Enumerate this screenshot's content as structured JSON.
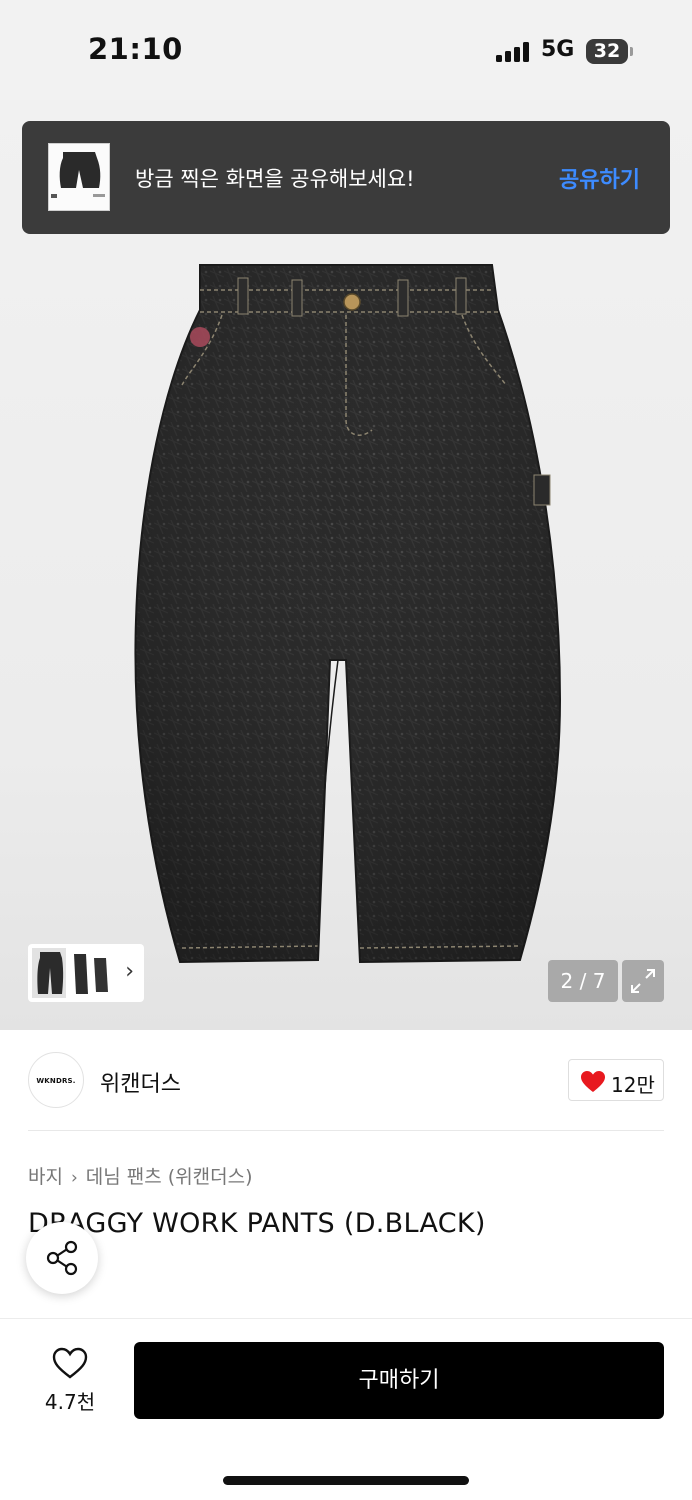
{
  "status_bar": {
    "time": "21:10",
    "network": "5G",
    "battery": "32"
  },
  "toast": {
    "message": "방금 찍은 화면을 공유해보세요!",
    "action": "공유하기"
  },
  "gallery": {
    "counter": "2 / 7",
    "thumb_arrow": "›"
  },
  "brand": {
    "logo_text": "WKNDRS.",
    "name": "위캔더스",
    "likes": "12만"
  },
  "breadcrumb": {
    "items": [
      "바지",
      "데님 팬츠 (위캔더스)"
    ],
    "separator": "›"
  },
  "product": {
    "title": "DRAGGY WORK PANTS (D.BLACK)"
  },
  "bottom_bar": {
    "wishlist_count": "4.7천",
    "buy_label": "구매하기"
  },
  "colors": {
    "accent_blue": "#3d8bff",
    "like_red": "#e8191f",
    "buy_black": "#000000",
    "toast_bg": "#3b3b3b"
  },
  "icons": [
    "signal-icon",
    "battery-icon",
    "heart-icon",
    "expand-icon",
    "share-icon",
    "wishlist-heart-icon",
    "chevron-right-icon"
  ]
}
